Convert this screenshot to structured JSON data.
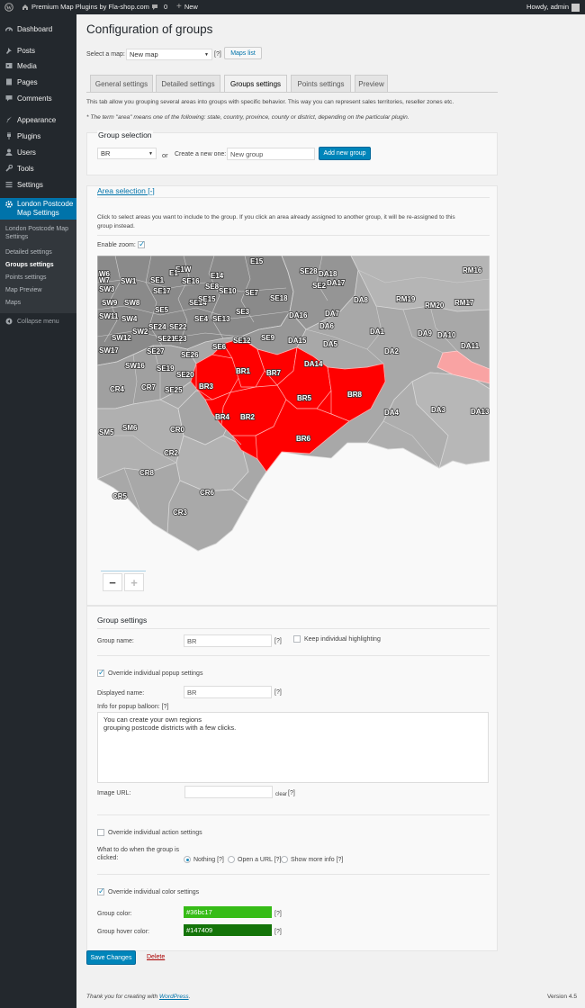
{
  "adminbar": {
    "site": "Premium Map Plugins by Fla-shop.com",
    "comments": "0",
    "new": "New",
    "howdy": "Howdy, admin"
  },
  "sidebar": {
    "items": [
      {
        "label": "Dashboard",
        "icon": "dashboard-icon"
      },
      {
        "label": "Posts",
        "icon": "pin-icon"
      },
      {
        "label": "Media",
        "icon": "media-icon"
      },
      {
        "label": "Pages",
        "icon": "pages-icon"
      },
      {
        "label": "Comments",
        "icon": "comments-icon"
      },
      {
        "label": "Appearance",
        "icon": "brush-icon"
      },
      {
        "label": "Plugins",
        "icon": "plugin-icon"
      },
      {
        "label": "Users",
        "icon": "users-icon"
      },
      {
        "label": "Tools",
        "icon": "wrench-icon"
      },
      {
        "label": "Settings",
        "icon": "settings-icon"
      }
    ],
    "active": {
      "label1": "London Postcode",
      "label2": "Map Settings"
    },
    "submenu": [
      "London Postcode Map Settings",
      "Detailed settings",
      "Groups settings",
      "Points settings",
      "Map Preview",
      "Maps"
    ],
    "collapse": "Collapse menu"
  },
  "page": {
    "title": "Configuration of groups",
    "select_map_label": "Select a map:",
    "map_value": "New map",
    "help": "[?]",
    "maps_list": "Maps list"
  },
  "tabs": [
    "General settings",
    "Detailed settings",
    "Groups settings",
    "Points settings",
    "Preview"
  ],
  "intro": "This tab allow you grouping several areas into groups with specific behavior. This way you can represent sales territories, reseller zones etc.",
  "note": "* The term \"area\" means one of the following: state, country, province, county or district, depending on the particular plugin.",
  "group_selection": {
    "title": "Group selection",
    "select_value": "BR",
    "or": "or",
    "create_label": "Create a new one:",
    "new_value": "New group",
    "add_button": "Add new group"
  },
  "area_selection": {
    "title": "Area selection [-]",
    "desc1": "Click to select areas you want to include to the group. If you click an area already assigned to another group, it will be re-assigned to this",
    "desc2": "group instead.",
    "enable_zoom": "Enable zoom:",
    "zoom_out": "−",
    "zoom_in": "+"
  },
  "map_labels": [
    "E15",
    "SE28",
    "DA18",
    "RM16",
    "W7",
    "SW1",
    "SE1",
    "E1W",
    "E14",
    "SE16",
    "SE2",
    "DA17",
    "SW3",
    "SE10",
    "SE7",
    "SE18",
    "DA8",
    "RM19",
    "RM20",
    "RM17",
    "SW8",
    "SE5",
    "SE17",
    "SE14",
    "SW9",
    "SE15",
    "SE3",
    "DA16",
    "DA7",
    "SW11",
    "SW4",
    "SE4",
    "SE13",
    "DA6",
    "SE24",
    "SE22",
    "SE9",
    "DA15",
    "DA1",
    "DA9",
    "DA10",
    "SW12",
    "SW2",
    "SE23",
    "SE12",
    "SE6",
    "DA5",
    "DA2",
    "DA11",
    "SW17",
    "SE27",
    "SE26",
    "DA14",
    "SW16",
    "SE19",
    "SE20",
    "BR1",
    "BR7",
    "CR4",
    "CR7",
    "SE25",
    "BR3",
    "BR5",
    "BR8",
    "BR4",
    "BR2",
    "DA4",
    "DA3",
    "DA13",
    "SM5",
    "SM6",
    "CR0",
    "BR6",
    "CR2",
    "CR8",
    "CR6",
    "CR5",
    "CR3",
    "E1",
    "SE8",
    "SE21",
    "W6"
  ],
  "group_settings": {
    "title": "Group settings",
    "name_label": "Group name:",
    "name_value": "BR",
    "keep_highlight": "Keep individual highlighting",
    "override_popup": "Override individual popup settings",
    "displayed_label": "Displayed name:",
    "displayed_value": "BR",
    "info_label": "Info for popup balloon: [?]",
    "info_line1": "You can create your own regions",
    "info_line2": "grouping postcode districts with a few clicks.",
    "image_label": "Image URL:",
    "image_value": "",
    "clear": "clear",
    "override_action": "Override individual action settings",
    "action_label1": "What to do when the group is",
    "action_label2": "clicked:",
    "opt_nothing": "Nothing",
    "opt_url": "Open a URL",
    "opt_info": "Show more info",
    "override_color": "Override individual color settings",
    "color_label": "Group color:",
    "color_value": "#36bc17",
    "hover_label": "Group hover color:",
    "hover_value": "#147409"
  },
  "footer": {
    "save": "Save Changes",
    "delete": "Delete",
    "thanks": "Thank you for creating with ",
    "wp": "WordPress",
    "thanks_end": ".",
    "version": "Version 4.5"
  },
  "colors": {
    "selected": "#ff0000",
    "hovered": "#f9a3a3",
    "area_dark": "#8c8c8c",
    "area_mid": "#a5a5a5",
    "area_light": "#bdbdbd",
    "group_color": "#36bc17",
    "group_hover": "#147409"
  }
}
